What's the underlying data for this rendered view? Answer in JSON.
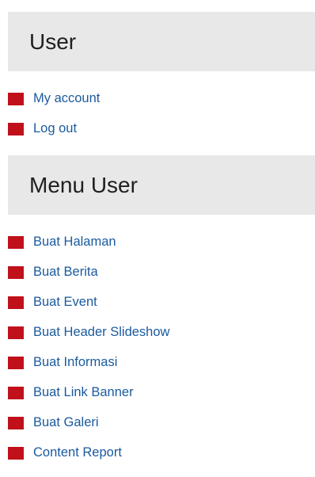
{
  "user_block": {
    "title": "User",
    "links": [
      "My account",
      "Log out"
    ]
  },
  "menu_user_block": {
    "title": "Menu User",
    "links": [
      "Buat Halaman",
      "Buat Berita",
      "Buat Event",
      "Buat Header Slideshow",
      "Buat Informasi",
      "Buat Link Banner",
      "Buat Galeri",
      "Content Report"
    ]
  },
  "colors": {
    "header_bg": "#e8e8e8",
    "bullet": "#c0101a",
    "link": "#1a5a9e"
  }
}
